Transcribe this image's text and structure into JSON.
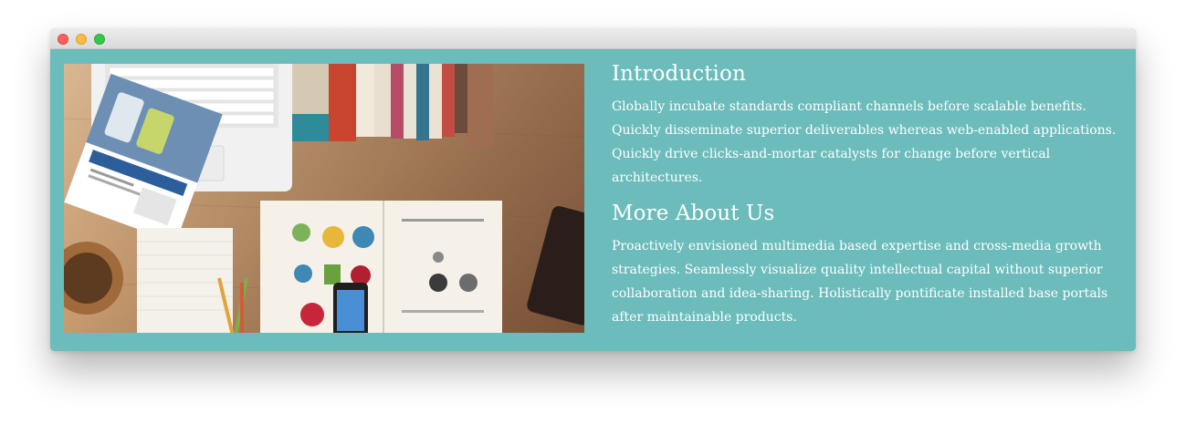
{
  "window": {
    "controls": [
      "close",
      "minimize",
      "maximize"
    ]
  },
  "hero": {
    "description_icons": [
      "laptop-icon",
      "ipod-brochure-icon",
      "books-icon",
      "notebook-icon",
      "phone-icon",
      "tablet-icon",
      "pencils-icon"
    ]
  },
  "intro": {
    "heading": "Introduction",
    "body": "Globally incubate standards compliant channels before scalable benefits. Quickly disseminate superior deliverables whereas web-enabled applications. Quickly drive clicks-and-mortar catalysts for change before vertical architectures."
  },
  "about": {
    "heading": "More About Us",
    "body": "Proactively envisioned multimedia based expertise and cross-media growth strategies. Seamlessly visualize quality intellectual capital without superior collaboration and idea-sharing. Holistically pontificate installed base portals after maintainable products."
  },
  "colors": {
    "background": "#6bbcbb",
    "text": "#ffffff"
  }
}
